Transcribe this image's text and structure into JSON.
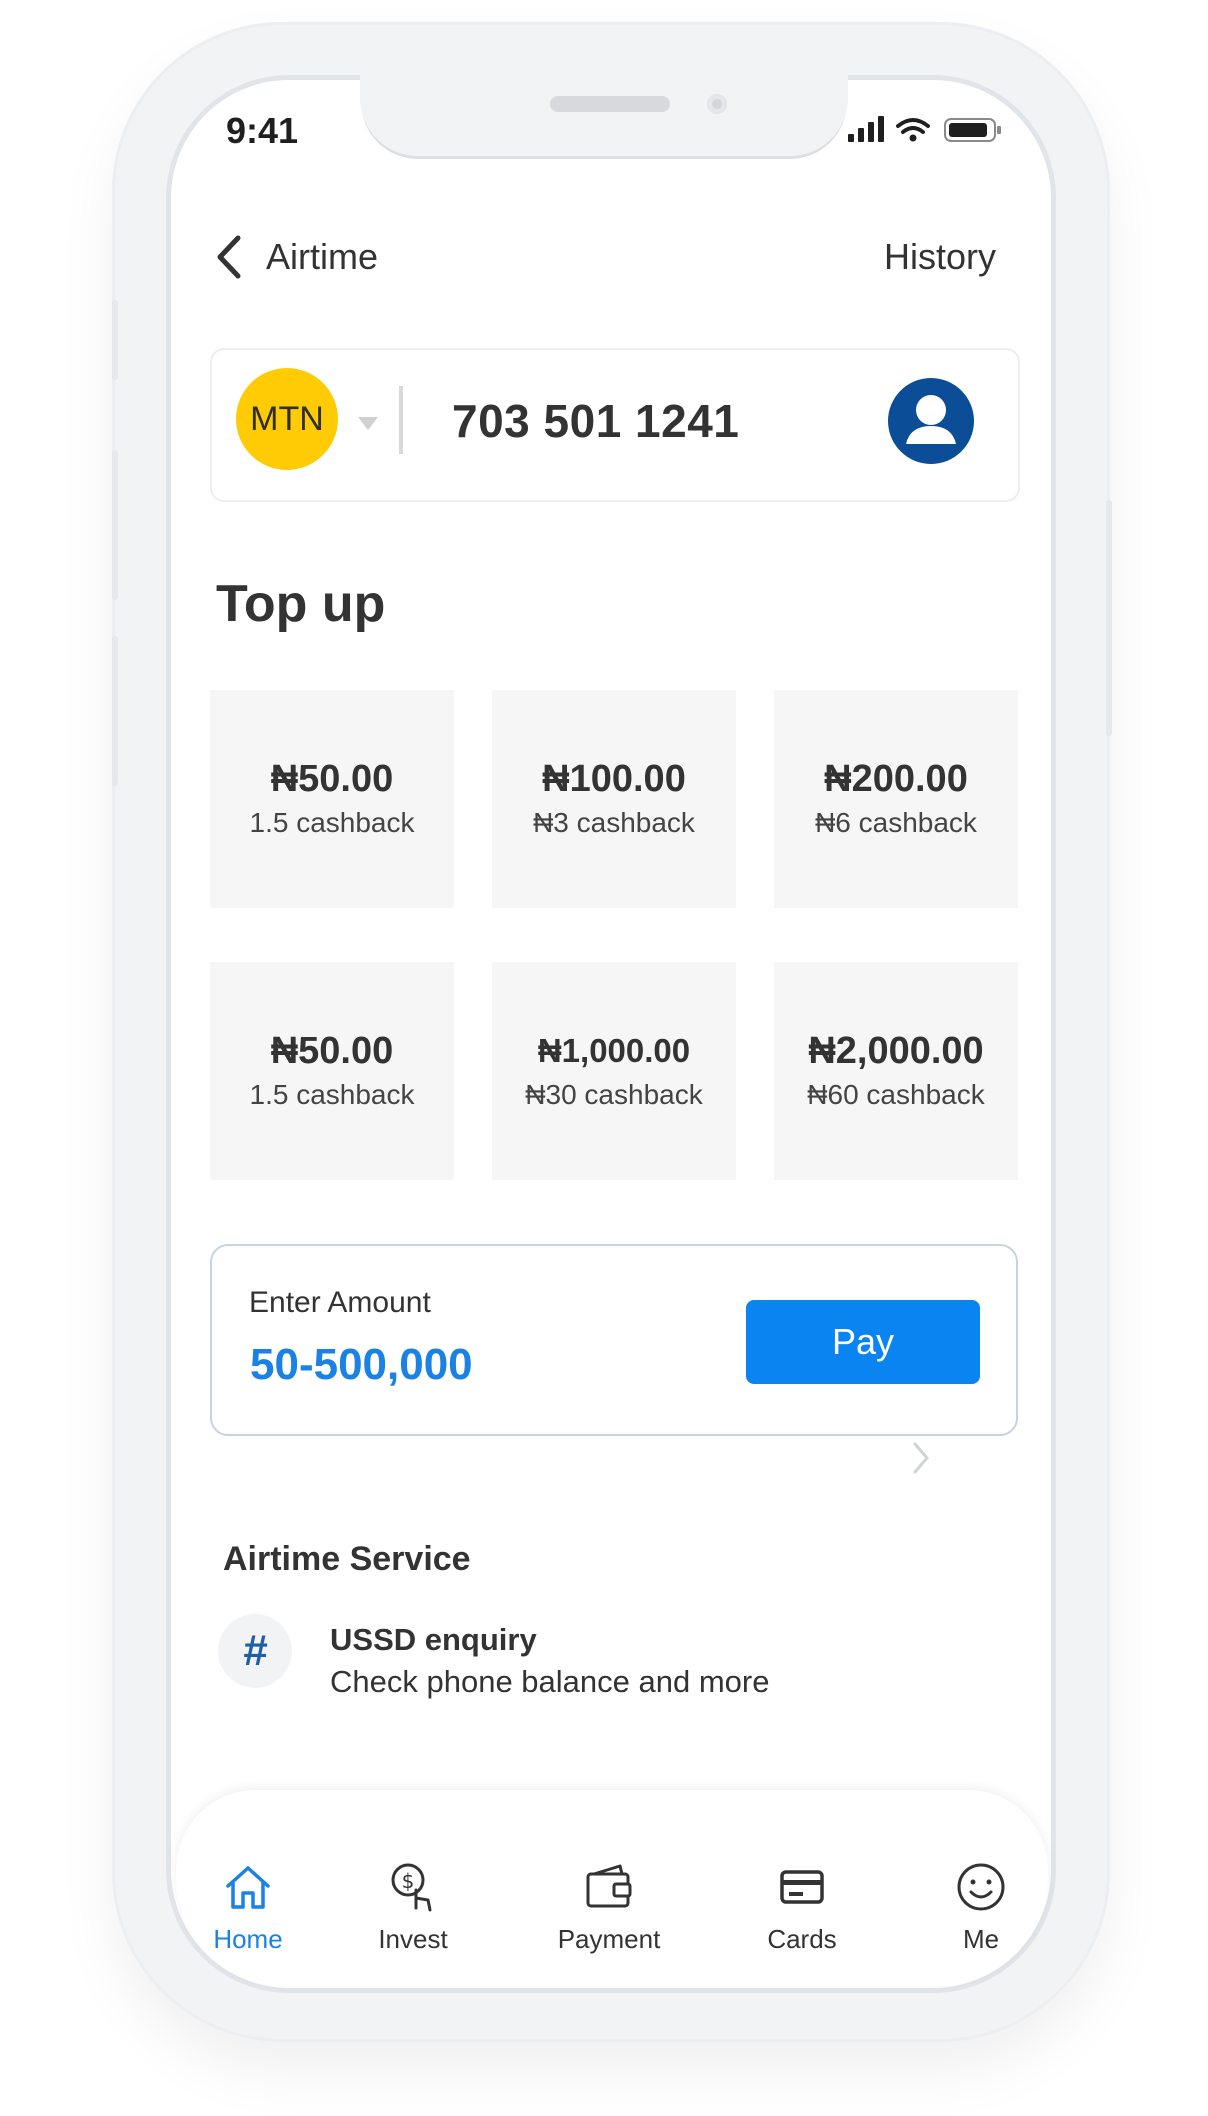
{
  "status_bar": {
    "time": "9:41"
  },
  "header": {
    "title": "Airtime",
    "history_label": "History"
  },
  "phone_card": {
    "network": "MTN",
    "number": "703 501 1241"
  },
  "topup": {
    "title": "Top up",
    "options": [
      {
        "amount": "₦50.00",
        "cashback": "1.5 cashback"
      },
      {
        "amount": "₦100.00",
        "cashback": "₦3 cashback"
      },
      {
        "amount": "₦200.00",
        "cashback": "₦6 cashback"
      },
      {
        "amount": "₦50.00",
        "cashback": "1.5 cashback"
      },
      {
        "amount": "₦1,000.00",
        "cashback": "₦30 cashback"
      },
      {
        "amount": "₦2,000.00",
        "cashback": "₦60 cashback"
      }
    ]
  },
  "amount_entry": {
    "label": "Enter Amount",
    "range": "50-500,000",
    "pay_label": "Pay"
  },
  "airtime_service": {
    "title": "Airtime Service",
    "items": [
      {
        "icon_text": "#",
        "title": "USSD enquiry",
        "subtitle": "Check phone balance and more"
      }
    ]
  },
  "tabbar": {
    "active": "Home",
    "tabs": [
      {
        "label": "Home",
        "icon": "home-icon"
      },
      {
        "label": "Invest",
        "icon": "invest-icon"
      },
      {
        "label": "Payment",
        "icon": "wallet-icon"
      },
      {
        "label": "Cards",
        "icon": "card-icon"
      },
      {
        "label": "Me",
        "icon": "smiley-icon"
      }
    ]
  },
  "colors": {
    "accent": "#0a84f0",
    "mtn_yellow": "#ffcb05",
    "contact_blue": "#0b4d96"
  }
}
